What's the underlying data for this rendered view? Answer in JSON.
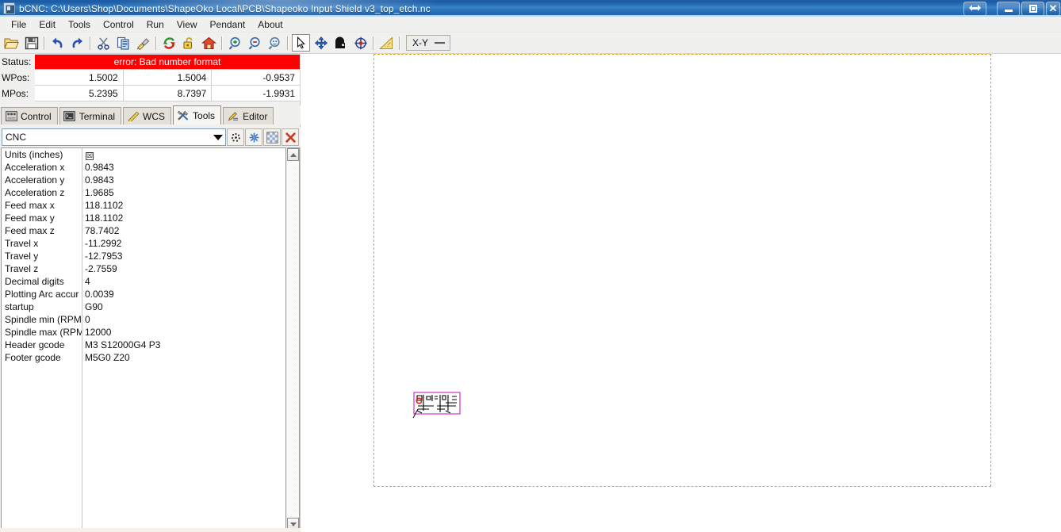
{
  "window": {
    "title": "bCNC: C:\\Users\\Shop\\Documents\\ShapeOko Local\\PCB\\Shapeoko Input Shield v3_top_etch.nc",
    "app_icon": "bcnc-app-icon",
    "controls": {
      "resize": "↔",
      "minimize": "–",
      "restore": "□",
      "close": "✕"
    }
  },
  "menubar": {
    "items": [
      {
        "label": "File"
      },
      {
        "label": "Edit"
      },
      {
        "label": "Tools"
      },
      {
        "label": "Control"
      },
      {
        "label": "Run"
      },
      {
        "label": "View"
      },
      {
        "label": "Pendant"
      },
      {
        "label": "About"
      }
    ]
  },
  "toolbar": {
    "buttons": [
      {
        "name": "open-file-button",
        "icon": "folder-open-icon"
      },
      {
        "name": "save-file-button",
        "icon": "floppy-disk-icon"
      },
      {
        "name": "undo-button",
        "icon": "undo-arrow-icon"
      },
      {
        "name": "redo-button",
        "icon": "redo-arrow-icon"
      },
      {
        "name": "cut-button",
        "icon": "scissors-icon"
      },
      {
        "name": "copy-button",
        "icon": "copy-pages-icon"
      },
      {
        "name": "paste-button",
        "icon": "paintbrush-icon"
      },
      {
        "name": "reset-button",
        "icon": "green-red-refresh-icon"
      },
      {
        "name": "unlock-button",
        "icon": "open-padlock-icon"
      },
      {
        "name": "home-button",
        "icon": "house-icon"
      },
      {
        "name": "zoom-in-button",
        "icon": "magnifier-plus-icon"
      },
      {
        "name": "zoom-out-button",
        "icon": "magnifier-minus-icon"
      },
      {
        "name": "zoom-fit-button",
        "icon": "magnifier-fit-icon"
      },
      {
        "name": "select-tool-button",
        "icon": "mouse-cursor-icon"
      },
      {
        "name": "pan-tool-button",
        "icon": "four-way-move-icon"
      },
      {
        "name": "gantry-tool-button",
        "icon": "gantry-icon"
      },
      {
        "name": "origin-tool-button",
        "icon": "crosshair-target-icon"
      },
      {
        "name": "ruler-tool-button",
        "icon": "yellow-triangle-ruler-icon"
      }
    ],
    "view_select": {
      "label": "X-Y"
    }
  },
  "status": {
    "status_label": "Status:",
    "status_value": "error: Bad number format",
    "status_color": "#fe0000",
    "wpos_label": "WPos:",
    "wpos": [
      "1.5002",
      "1.5004",
      "-0.9537"
    ],
    "mpos_label": "MPos:",
    "mpos": [
      "5.2395",
      "8.7397",
      "-1.9931"
    ]
  },
  "tabs": [
    {
      "label": "Control",
      "icon": "control-panel-icon",
      "active": false
    },
    {
      "label": "Terminal",
      "icon": "terminal-screen-icon",
      "active": false
    },
    {
      "label": "WCS",
      "icon": "yellow-ruler-icon",
      "active": false
    },
    {
      "label": "Tools",
      "icon": "crossed-tools-icon",
      "active": true
    },
    {
      "label": "Editor",
      "icon": "pencil-edit-icon",
      "active": false
    }
  ],
  "toolbox": {
    "selector_value": "CNC",
    "dropdown_icon": "chevron-down-icon",
    "buttons": [
      {
        "name": "add-clone-item-button",
        "icon": "scatter-dots-icon"
      },
      {
        "name": "add-item-button",
        "icon": "blue-asterisk-icon"
      },
      {
        "name": "clone-item-button",
        "icon": "checkered-clone-icon"
      },
      {
        "name": "delete-item-button",
        "icon": "red-x-delete-icon"
      }
    ]
  },
  "properties": [
    {
      "name": "Units (inches)",
      "value": "",
      "checkbox": true,
      "checked": true
    },
    {
      "name": "Acceleration x",
      "value": "0.9843"
    },
    {
      "name": "Acceleration y",
      "value": "0.9843"
    },
    {
      "name": "Acceleration z",
      "value": "1.9685"
    },
    {
      "name": "Feed max x",
      "value": "118.1102"
    },
    {
      "name": "Feed max y",
      "value": "118.1102"
    },
    {
      "name": "Feed max z",
      "value": "78.7402"
    },
    {
      "name": "Travel x",
      "value": "-11.2992"
    },
    {
      "name": "Travel y",
      "value": "-12.7953"
    },
    {
      "name": "Travel z",
      "value": "-2.7559"
    },
    {
      "name": "Decimal digits",
      "value": "4"
    },
    {
      "name": "Plotting Arc accur",
      "value": "0.0039"
    },
    {
      "name": "startup",
      "value": "G90"
    },
    {
      "name": "Spindle min (RPM",
      "value": "0"
    },
    {
      "name": "Spindle max (RPM",
      "value": "12000"
    },
    {
      "name": "Header gcode",
      "value": "M3 S12000G4 P3"
    },
    {
      "name": "Footer gcode",
      "value": "M5G0 Z20"
    }
  ],
  "scrollbar": {
    "up_icon": "scroll-up-arrow-icon",
    "down_icon": "scroll-down-arrow-icon"
  },
  "canvas": {
    "margin_border_color": "#d9a616",
    "toolpath_outline_color": "#cc33cc",
    "toolpath_path_color": "#000000",
    "toolpath_marker_color": "#dd2222"
  }
}
